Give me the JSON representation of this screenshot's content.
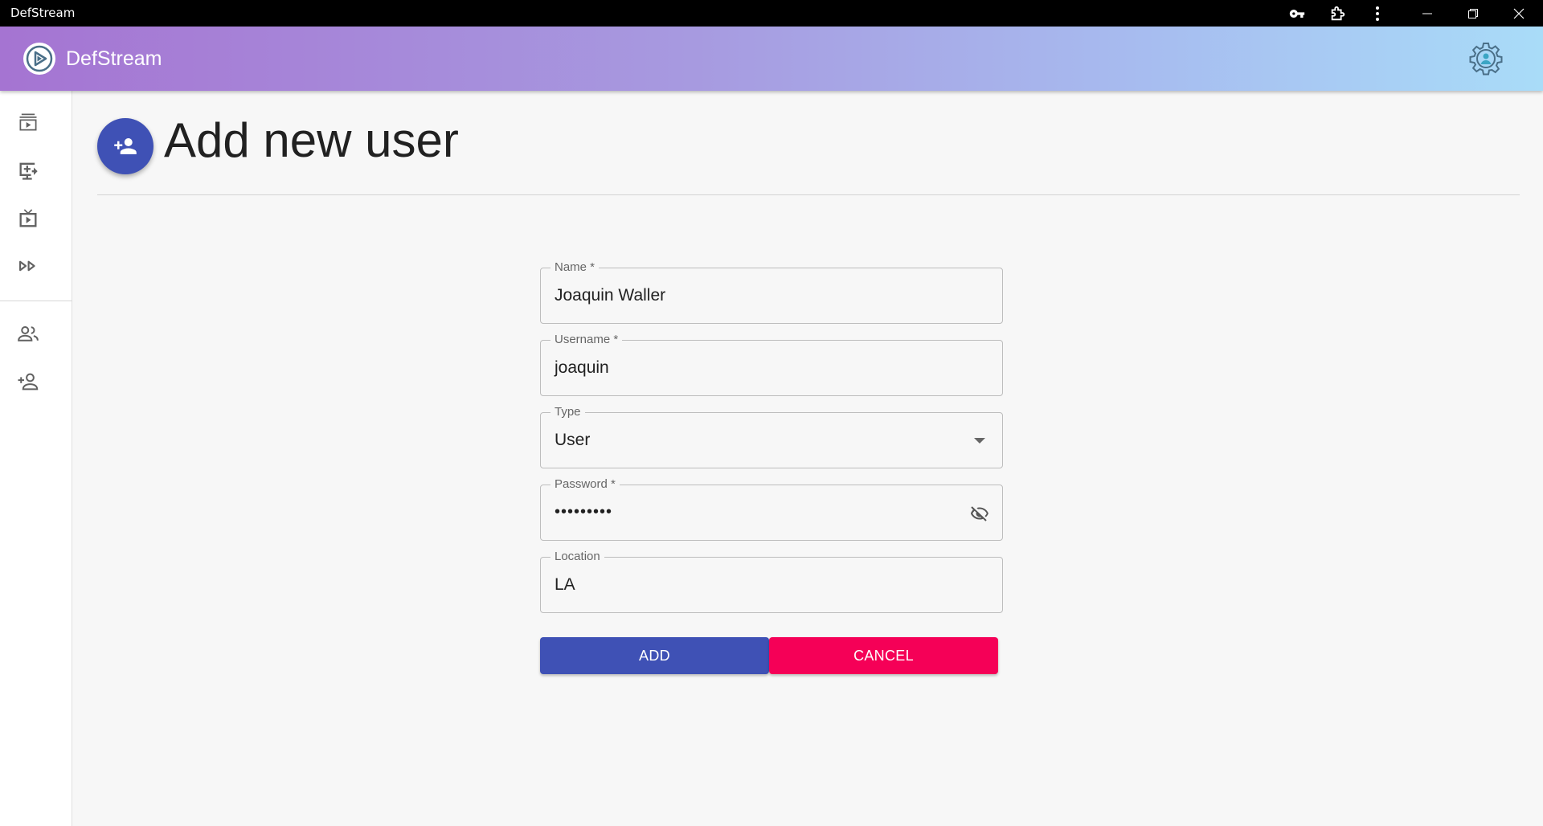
{
  "window": {
    "title": "DefStream"
  },
  "appbar": {
    "app_name": "DefStream"
  },
  "sidebar": {
    "items": [
      {
        "name": "streams-icon"
      },
      {
        "name": "add-screen-icon"
      },
      {
        "name": "live-tv-icon"
      },
      {
        "name": "fast-forward-icon"
      },
      {
        "name": "users-icon"
      },
      {
        "name": "add-user-icon"
      }
    ]
  },
  "page": {
    "title": "Add new user"
  },
  "form": {
    "name": {
      "label": "Name *",
      "value": "Joaquin Waller"
    },
    "username": {
      "label": "Username *",
      "value": "joaquin"
    },
    "type": {
      "label": "Type",
      "value": "User"
    },
    "password": {
      "label": "Password *",
      "value": "•••••••••"
    },
    "location": {
      "label": "Location",
      "value": "LA"
    }
  },
  "buttons": {
    "add": "ADD",
    "cancel": "CANCEL"
  },
  "colors": {
    "primary": "#3f51b5",
    "secondary": "#f50057"
  }
}
